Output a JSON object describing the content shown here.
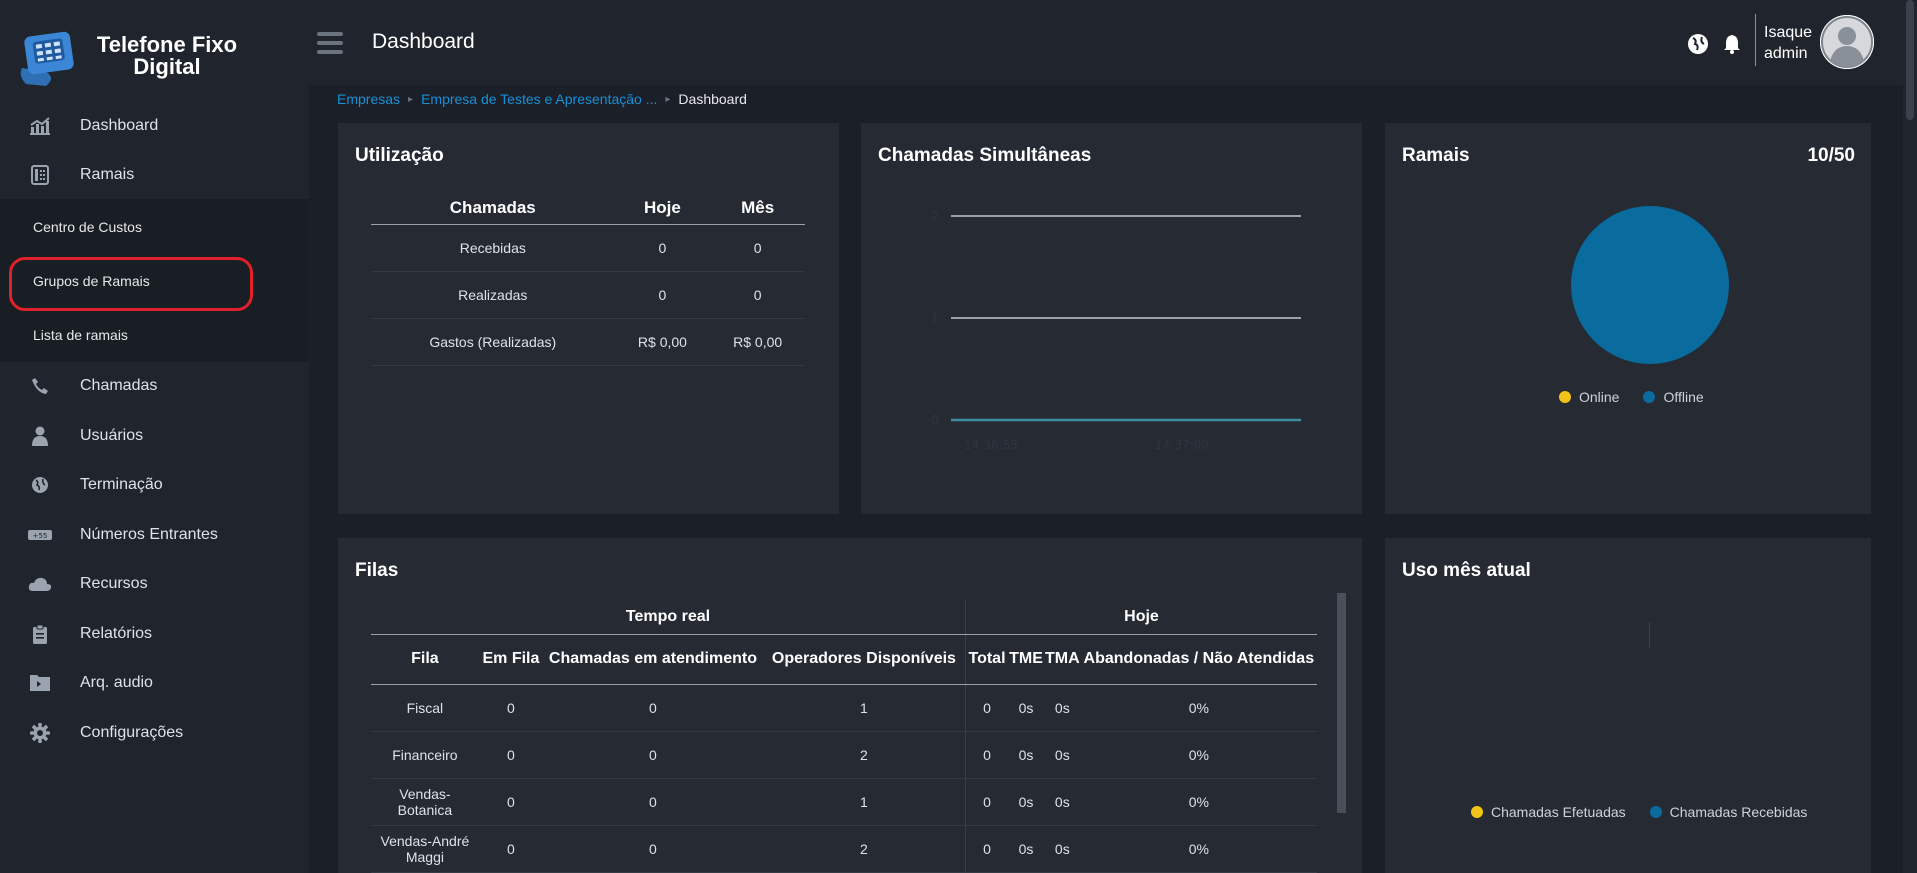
{
  "brand": {
    "title_line1": "Telefone Fixo",
    "title_line2": "Digital"
  },
  "sidebar": {
    "items": [
      {
        "label": "Dashboard",
        "icon": "chart-icon"
      },
      {
        "label": "Ramais",
        "icon": "phone-extension-icon"
      },
      {
        "label": "Chamadas",
        "icon": "phone-icon"
      },
      {
        "label": "Usuários",
        "icon": "user-icon"
      },
      {
        "label": "Terminação",
        "icon": "globe-icon"
      },
      {
        "label": "Números Entrantes",
        "icon": "number-icon"
      },
      {
        "label": "Recursos",
        "icon": "cloud-icon"
      },
      {
        "label": "Relatórios",
        "icon": "clipboard-icon"
      },
      {
        "label": "Arq. audio",
        "icon": "audio-folder-icon"
      },
      {
        "label": "Configurações",
        "icon": "gear-icon"
      }
    ],
    "subitems": [
      {
        "label": "Centro de Custos"
      },
      {
        "label": "Grupos de Ramais"
      },
      {
        "label": "Lista de ramais"
      }
    ]
  },
  "header": {
    "title": "Dashboard",
    "user_line1": "Isaque",
    "user_line2": "admin"
  },
  "breadcrumb": {
    "link1": "Empresas",
    "link2": "Empresa de Testes e Apresentação ...",
    "current": "Dashboard"
  },
  "utilizacao": {
    "title": "Utilização",
    "headers": [
      "Chamadas",
      "Hoje",
      "Mês"
    ],
    "rows": [
      [
        "Recebidas",
        "0",
        "0"
      ],
      [
        "Realizadas",
        "0",
        "0"
      ],
      [
        "Gastos (Realizadas)",
        "R$ 0,00",
        "R$ 0,00"
      ]
    ]
  },
  "simultaneas": {
    "title": "Chamadas Simultâneas",
    "y_ticks": [
      "2",
      "1",
      "0"
    ],
    "x_ticks": [
      "14:36:55",
      "14:37:00"
    ]
  },
  "ramais": {
    "title": "Ramais",
    "count": "10/50",
    "legend": [
      {
        "label": "Online",
        "color": "#f2c318"
      },
      {
        "label": "Offline",
        "color": "#096b9e"
      }
    ]
  },
  "filas": {
    "title": "Filas",
    "group_realtime": "Tempo real",
    "group_today": "Hoje",
    "headers": [
      "Fila",
      "Em Fila",
      "Chamadas em atendimento",
      "Operadores Disponíveis",
      "Total",
      "TME",
      "TMA",
      "Abandonadas / Não Atendidas"
    ],
    "rows": [
      [
        "Fiscal",
        "0",
        "0",
        "1",
        "0",
        "0s",
        "0s",
        "0%"
      ],
      [
        "Financeiro",
        "0",
        "0",
        "2",
        "0",
        "0s",
        "0s",
        "0%"
      ],
      [
        "Vendas-Botanica",
        "0",
        "0",
        "1",
        "0",
        "0s",
        "0s",
        "0%"
      ],
      [
        "Vendas-André Maggi",
        "0",
        "0",
        "2",
        "0",
        "0s",
        "0s",
        "0%"
      ]
    ]
  },
  "uso": {
    "title": "Uso mês atual",
    "legend": [
      {
        "label": "Chamadas Efetuadas",
        "color": "#f2c318"
      },
      {
        "label": "Chamadas Recebidas",
        "color": "#096b9e"
      }
    ]
  },
  "colors": {
    "accent": "#1a8fd6",
    "offline": "#096b9e",
    "online": "#f2c318",
    "highlight": "#e0202a"
  }
}
